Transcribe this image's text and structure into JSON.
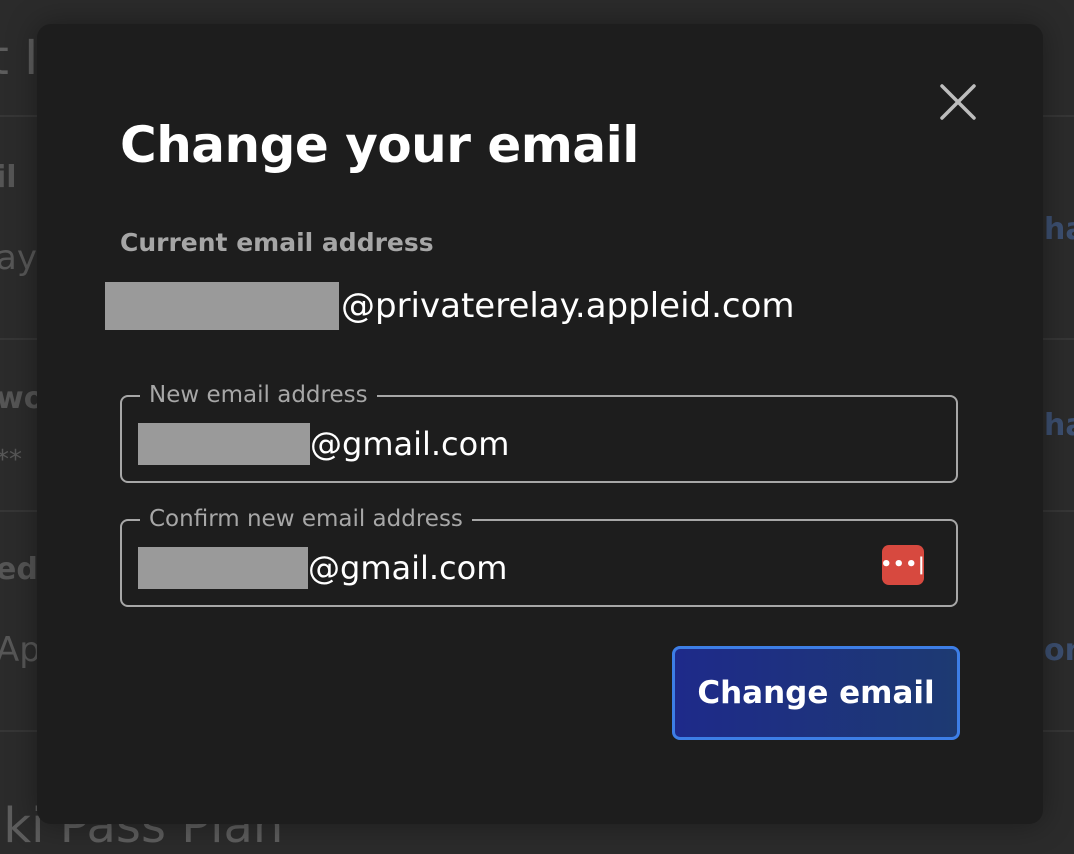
{
  "background": {
    "heading_fragment": "t In",
    "row1_label_fragment": "il",
    "row1_value_fragment": "ayt",
    "row1_link_fragment": "ha",
    "row2_label_fragment": "wo",
    "row2_value_fragment": "**",
    "row2_link_fragment": "ha",
    "row3_label_fragment": "ed",
    "row3_value_fragment": "Ap",
    "row3_link_fragment": "on",
    "footer_fragment": "iki Pass Plan"
  },
  "modal": {
    "title": "Change your email",
    "close_icon": "close-icon",
    "current_label": "Current email address",
    "current_email_domain": "@privaterelay.appleid.com",
    "new_email": {
      "legend": "New email address",
      "value_domain": "@gmail.com"
    },
    "confirm_email": {
      "legend": "Confirm new email address",
      "value_domain": "@gmail.com",
      "password_manager_icon": "password-manager-icon",
      "password_manager_glyph": "•••|"
    },
    "submit_label": "Change email"
  },
  "colors": {
    "modal_bg": "#1d1d1d",
    "button_border": "#3d7ee6",
    "button_fill": "#1e2a8a",
    "password_manager": "#d7493f"
  }
}
